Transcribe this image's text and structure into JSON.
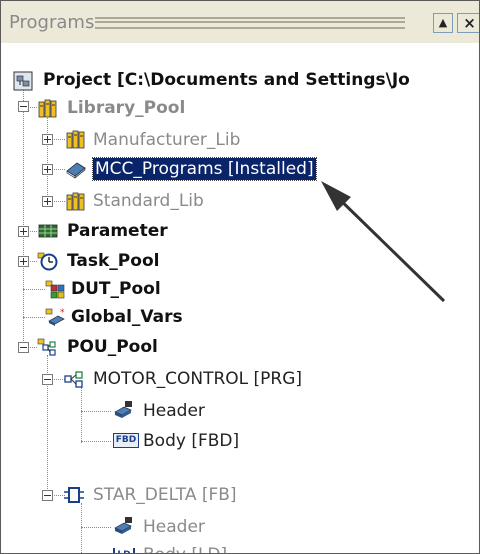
{
  "panel": {
    "title": "Programs"
  },
  "tree": {
    "project": "Project [C:\\Documents and Settings\\Jo",
    "library_pool": "Library_Pool",
    "manufacturer_lib": "Manufacturer_Lib",
    "mcc_programs": "MCC_Programs [Installed]",
    "standard_lib": "Standard_Lib",
    "parameter": "Parameter",
    "task_pool": "Task_Pool",
    "dut_pool": "DUT_Pool",
    "global_vars": "Global_Vars",
    "pou_pool": "POU_Pool",
    "motor_control": "MOTOR_CONTROL [PRG]",
    "motor_header": "Header",
    "motor_body": "Body [FBD]",
    "star_delta": "STAR_DELTA [FB]",
    "star_header": "Header",
    "star_body": "Body [LD]"
  },
  "icons": {
    "fbd_badge": "FBD",
    "ld_badge": "LD"
  },
  "colors": {
    "selection": "#0a246a",
    "folder_yellow": "#f0c020",
    "disabled_text": "#8a8a8a"
  }
}
